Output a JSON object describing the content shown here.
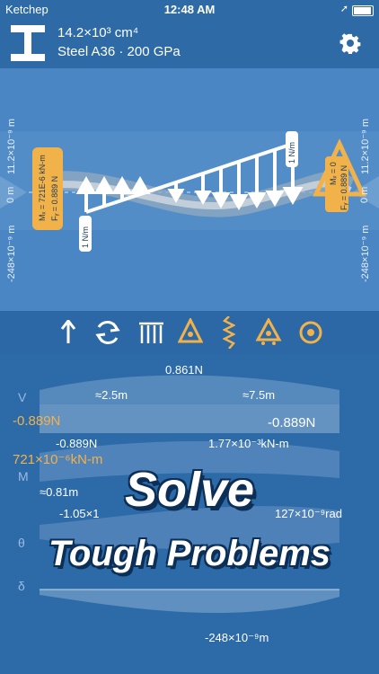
{
  "status_bar": {
    "carrier": "Ketchep",
    "time": "12:48 AM",
    "location_arrow": "➚"
  },
  "header": {
    "moment_of_inertia": "14.2×10³ cm⁴",
    "material": "Steel A36 · 200 GPa"
  },
  "diagram": {
    "left_axis_top": "11.2×10⁻⁹ m",
    "left_axis_mid": "0 m",
    "left_axis_bottom": "-248×10⁻⁹ m",
    "right_axis_top": "11.2×10⁻⁹ m",
    "right_axis_mid": "0 m",
    "right_axis_bottom": "-248×10⁻⁹ m",
    "left_support_moment": "Mₓ = 721E-6 kN-m",
    "left_support_force": "Fᵧ = 0.889 N",
    "right_support_moment": "Mₓ = 0",
    "right_support_force": "Fᵧ = 0.889 N",
    "load_left_label": "1 N/m",
    "load_right_label": "1 N/m"
  },
  "toolbar": {
    "icons": [
      "arrow-up-icon",
      "refresh-icon",
      "distributed-load-icon",
      "pin-support-icon",
      "spring-icon",
      "roller-support-icon",
      "target-icon"
    ]
  },
  "results": {
    "shear_label": "V",
    "moment_label": "M",
    "rotation_label": "θ",
    "deflection_label": "δ",
    "shear_max": "0.861N",
    "shear_x1": "≈2.5m",
    "shear_x2": "≈7.5m",
    "shear_left": "-0.889N",
    "shear_right": "-0.889N",
    "shear_left2": "-0.889N",
    "moment_left": "721×10⁻⁶kN-m",
    "moment_right": "1.77×10⁻³kN-m",
    "moment_x": "≈0.81m",
    "moment_min": "-1.05×1",
    "rotation_value": "127×10⁻⁹rad",
    "deflection_min": "-248×10⁻⁹m"
  },
  "banner": {
    "line1": "Solve",
    "line2": "Tough Problems"
  },
  "colors": {
    "accent": "#f2b24a",
    "bg": "#2c6aa8",
    "panel": "#4a86c4"
  }
}
